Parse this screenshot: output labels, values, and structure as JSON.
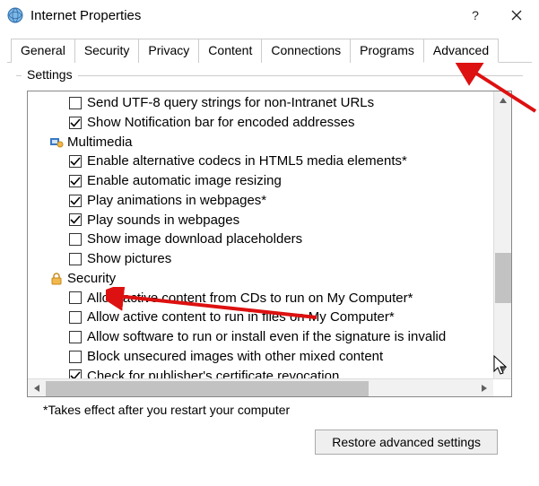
{
  "title": "Internet Properties",
  "tabs": [
    "General",
    "Security",
    "Privacy",
    "Content",
    "Connections",
    "Programs",
    "Advanced"
  ],
  "active_tab_index": 6,
  "group_label": "Settings",
  "items": [
    {
      "type": "chk",
      "checked": false,
      "label": "Send UTF-8 query strings for non-Intranet URLs"
    },
    {
      "type": "chk",
      "checked": true,
      "label": "Show Notification bar for encoded addresses"
    },
    {
      "type": "cat",
      "icon": "multimedia",
      "label": "Multimedia"
    },
    {
      "type": "chk",
      "checked": true,
      "label": "Enable alternative codecs in HTML5 media elements*"
    },
    {
      "type": "chk",
      "checked": true,
      "label": "Enable automatic image resizing"
    },
    {
      "type": "chk",
      "checked": true,
      "label": "Play animations in webpages*"
    },
    {
      "type": "chk",
      "checked": true,
      "label": "Play sounds in webpages"
    },
    {
      "type": "chk",
      "checked": false,
      "label": "Show image download placeholders"
    },
    {
      "type": "chk",
      "checked": false,
      "label": "Show pictures"
    },
    {
      "type": "cat",
      "icon": "security",
      "label": "Security"
    },
    {
      "type": "chk",
      "checked": false,
      "label": "Allow active content from CDs to run on My Computer*"
    },
    {
      "type": "chk",
      "checked": false,
      "label": "Allow active content to run in files on My Computer*"
    },
    {
      "type": "chk",
      "checked": false,
      "label": "Allow software to run or install even if the signature is invalid"
    },
    {
      "type": "chk",
      "checked": false,
      "label": "Block unsecured images with other mixed content"
    },
    {
      "type": "chk",
      "checked": true,
      "label": "Check for publisher's certificate revocation"
    }
  ],
  "note": "*Takes effect after you restart your computer",
  "restore_button": "Restore advanced settings"
}
